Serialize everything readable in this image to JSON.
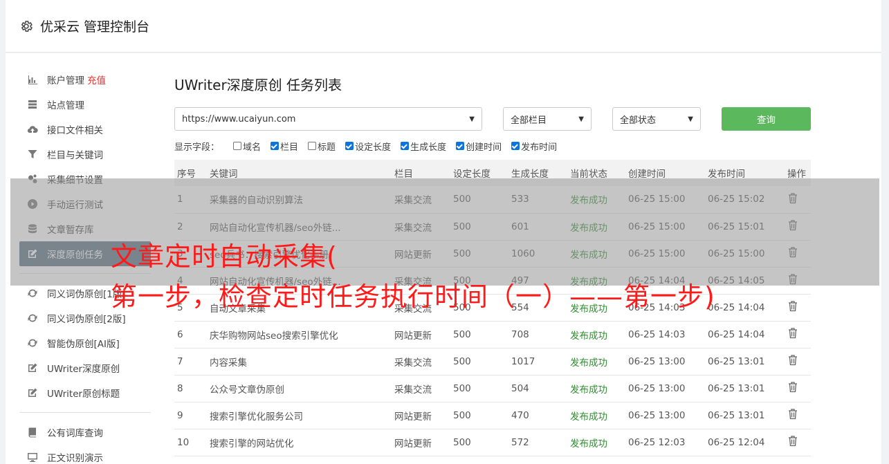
{
  "header": {
    "title": "优采云 管理控制台"
  },
  "sidebar": {
    "group1": [
      {
        "label": "账户管理",
        "badge": "充值",
        "icon": "bar-chart-icon",
        "name": "sidebar-item-account"
      },
      {
        "label": "站点管理",
        "icon": "server-icon",
        "name": "sidebar-item-sites"
      },
      {
        "label": "接口文件相关",
        "icon": "cloud-upload-icon",
        "name": "sidebar-item-interface"
      },
      {
        "label": "栏目与关键词",
        "icon": "filter-icon",
        "name": "sidebar-item-columns"
      },
      {
        "label": "采集细节设置",
        "icon": "gears-icon",
        "name": "sidebar-item-collect-settings"
      },
      {
        "label": "手动运行测试",
        "icon": "play-icon",
        "name": "sidebar-item-manual-run"
      },
      {
        "label": "文章暂存库",
        "icon": "database-icon",
        "name": "sidebar-item-article-store"
      },
      {
        "label": "深度原创任务",
        "icon": "edit-icon",
        "name": "sidebar-item-deep-original",
        "active": true
      }
    ],
    "group2": [
      {
        "label": "同义词伪原创[1版]",
        "icon": "refresh-icon",
        "name": "sidebar-item-synonym-v1"
      },
      {
        "label": "同义词伪原创[2版]",
        "icon": "refresh-icon",
        "name": "sidebar-item-synonym-v2"
      },
      {
        "label": "智能伪原创[AI版]",
        "icon": "refresh-icon",
        "name": "sidebar-item-ai-rewrite"
      },
      {
        "label": "UWriter深度原创",
        "icon": "edit-icon",
        "name": "sidebar-item-uwriter"
      },
      {
        "label": "UWriter原创标题",
        "icon": "edit-icon",
        "name": "sidebar-item-uwriter-title"
      }
    ],
    "group3": [
      {
        "label": "公有词库查询",
        "icon": "book-icon",
        "name": "sidebar-item-lexicon"
      },
      {
        "label": "正文识别演示",
        "icon": "monitor-icon",
        "name": "sidebar-item-text-recognition"
      }
    ]
  },
  "main": {
    "title": "UWriter深度原创 任务列表",
    "site_select": "https://www.ucaiyun.com",
    "column_select": "全部栏目",
    "status_select": "全部状态",
    "query_button": "查询",
    "fields_label": "显示字段：",
    "fields": [
      {
        "label": "域名",
        "checked": false
      },
      {
        "label": "栏目",
        "checked": true
      },
      {
        "label": "标题",
        "checked": false
      },
      {
        "label": "设定长度",
        "checked": true
      },
      {
        "label": "生成长度",
        "checked": true
      },
      {
        "label": "创建时间",
        "checked": true
      },
      {
        "label": "发布时间",
        "checked": true
      }
    ],
    "table": {
      "headers": [
        "序号",
        "关键词",
        "栏目",
        "设定长度",
        "生成长度",
        "当前状态",
        "创建时间",
        "发布时间",
        "操作"
      ],
      "rows": [
        [
          "1",
          "采集器的自动识别算法",
          "采集交流",
          "500",
          "533",
          "发布成功",
          "06-25 15:00",
          "06-25 15:02"
        ],
        [
          "2",
          "网站自动化宣传机器/seo外链...",
          "采集交流",
          "500",
          "601",
          "发布成功",
          "06-25 15:00",
          "06-25 15:01"
        ],
        [
          "3",
          "seo兵书：搜索引擎优化手册",
          "网站更新",
          "500",
          "1060",
          "发布成功",
          "06-25 15:00",
          "06-25 15:00"
        ],
        [
          "4",
          "网站自动化宣传机器/seo外链...",
          "采集交流",
          "500",
          "497",
          "发布成功",
          "06-25 14:04",
          "06-25 14:05"
        ],
        [
          "5",
          "自动文章采集",
          "采集交流",
          "500",
          "554",
          "发布成功",
          "06-25 14:03",
          "06-25 14:04"
        ],
        [
          "6",
          "庆华购物网站seo搜索引擎优化",
          "网站更新",
          "500",
          "708",
          "发布成功",
          "06-25 14:03",
          "06-25 14:04"
        ],
        [
          "7",
          "内容采集",
          "采集交流",
          "500",
          "1017",
          "发布成功",
          "06-25 13:00",
          "06-25 13:01"
        ],
        [
          "8",
          "公众号文章伪原创",
          "采集交流",
          "500",
          "504",
          "发布成功",
          "06-25 13:00",
          "06-25 13:01"
        ],
        [
          "9",
          "搜索引擎优化服务公司",
          "网站更新",
          "500",
          "470",
          "发布成功",
          "06-25 13:00",
          "06-25 13:01"
        ],
        [
          "10",
          "搜索引擎的网站优化",
          "网站更新",
          "500",
          "572",
          "发布成功",
          "06-25 12:03",
          "06-25 12:04"
        ]
      ]
    }
  },
  "overlay": {
    "line1": "文章定时自动采集(",
    "line2": "第一步，检查定时任务执行时间（一）——第一步)"
  },
  "colors": {
    "active_nav": "#5a6f84",
    "query_button": "#5cb85c",
    "success": "#2f8f2f",
    "badge": "#e03131",
    "overlay_text": "#ff1a1a"
  }
}
